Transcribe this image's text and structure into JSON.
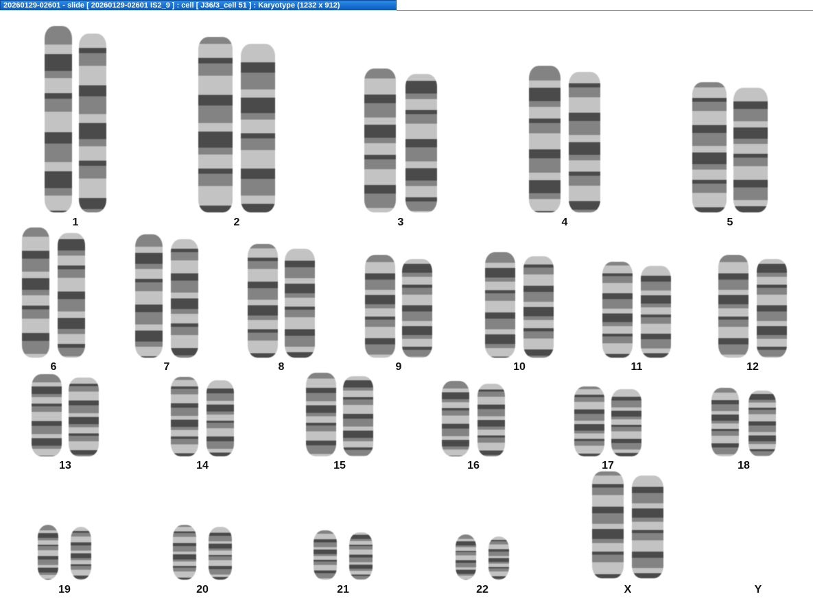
{
  "window": {
    "title": "20260129-02601 - slide [ 20260129-02601 IS2_9 ] : cell [ J36/3_cell 51 ] : Karyotype  (1232 x 912)"
  },
  "karyotype": {
    "chromosomes": [
      {
        "label": "1",
        "count": 2
      },
      {
        "label": "2",
        "count": 2
      },
      {
        "label": "3",
        "count": 2
      },
      {
        "label": "4",
        "count": 2
      },
      {
        "label": "5",
        "count": 2
      },
      {
        "label": "6",
        "count": 2
      },
      {
        "label": "7",
        "count": 2
      },
      {
        "label": "8",
        "count": 2
      },
      {
        "label": "9",
        "count": 2
      },
      {
        "label": "10",
        "count": 2
      },
      {
        "label": "11",
        "count": 2
      },
      {
        "label": "12",
        "count": 2
      },
      {
        "label": "13",
        "count": 2
      },
      {
        "label": "14",
        "count": 2
      },
      {
        "label": "15",
        "count": 2
      },
      {
        "label": "16",
        "count": 2
      },
      {
        "label": "17",
        "count": 2
      },
      {
        "label": "18",
        "count": 2
      },
      {
        "label": "19",
        "count": 2
      },
      {
        "label": "20",
        "count": 2
      },
      {
        "label": "21",
        "count": 2
      },
      {
        "label": "22",
        "count": 2
      },
      {
        "label": "X",
        "count": 2
      },
      {
        "label": "Y",
        "count": 0
      }
    ]
  }
}
